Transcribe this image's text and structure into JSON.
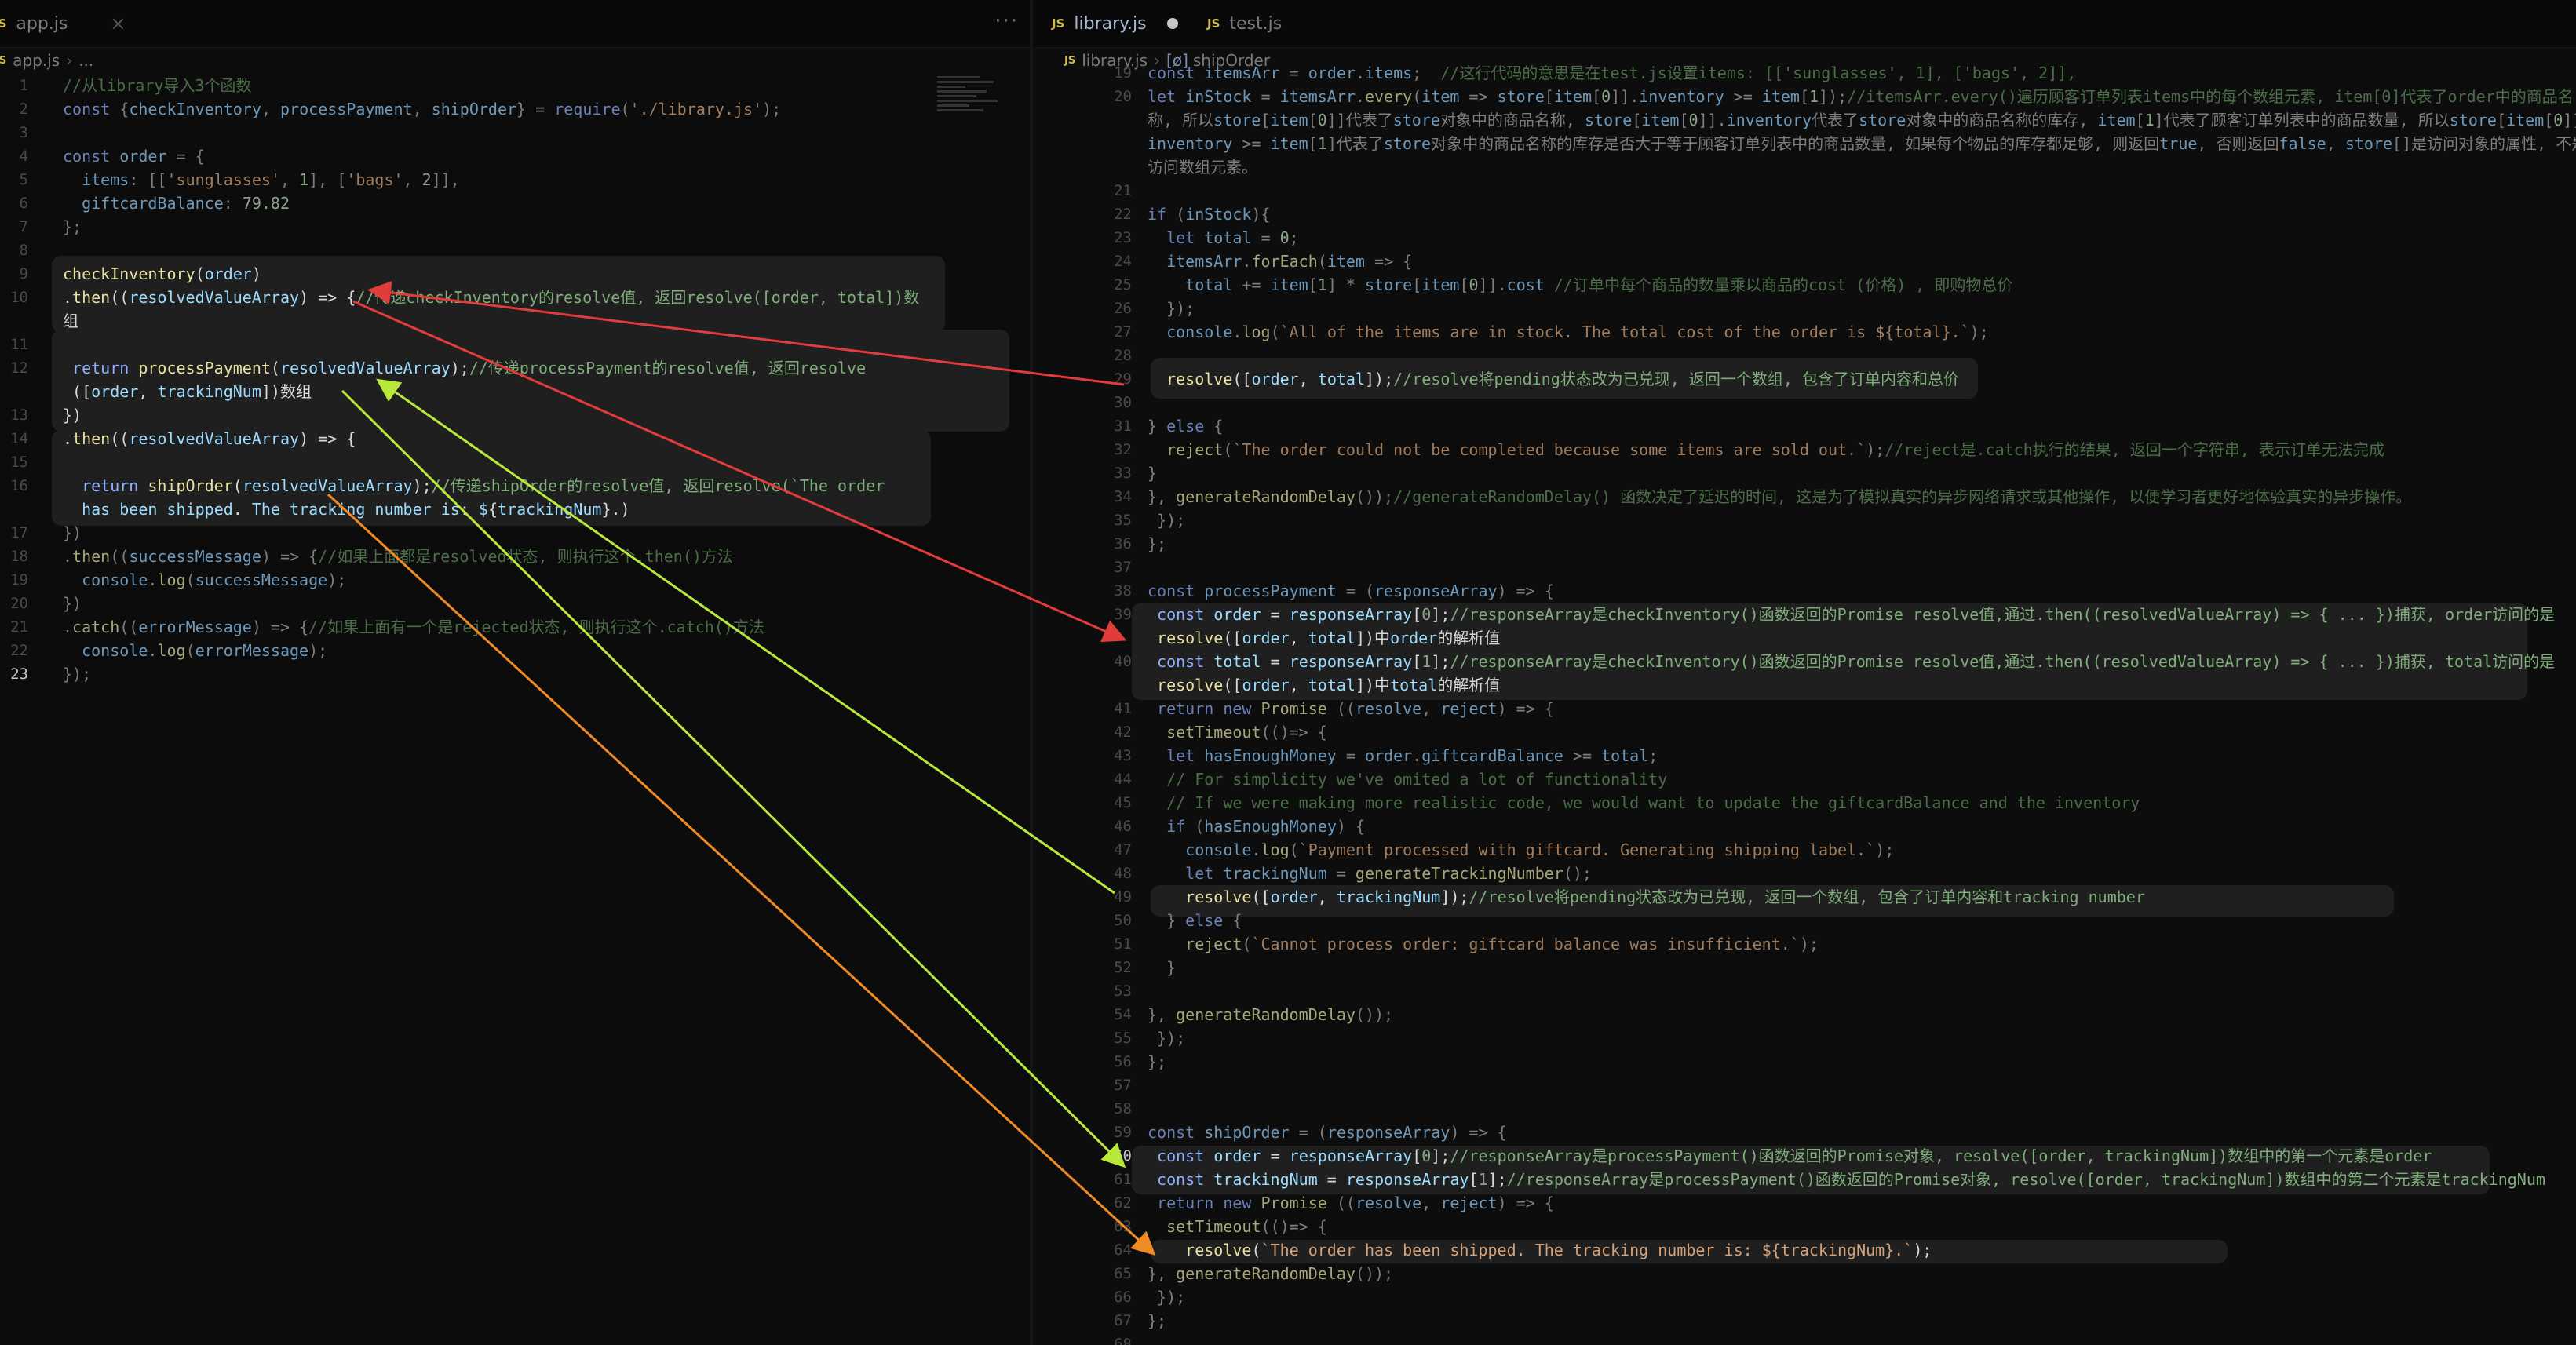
{
  "left_pane": {
    "tabs": [
      {
        "label": "app.js",
        "icon": "JS"
      }
    ],
    "more_label": "···",
    "breadcrumb": [
      "app.js",
      "..."
    ],
    "current_line": 23,
    "lines": [
      {
        "n": 1,
        "text": "//从library导入3个函数"
      },
      {
        "n": 2,
        "text": "const {checkInventory, processPayment, shipOrder} = require('./library.js');"
      },
      {
        "n": 3,
        "text": ""
      },
      {
        "n": 4,
        "text": "const order = {"
      },
      {
        "n": 5,
        "text": "  items: [['sunglasses', 1], ['bags', 2]],"
      },
      {
        "n": 6,
        "text": "  giftcardBalance: 79.82"
      },
      {
        "n": 7,
        "text": "};"
      },
      {
        "n": 8,
        "text": ""
      },
      {
        "n": 9,
        "text": "checkInventory(order)",
        "lit": true
      },
      {
        "n": 10,
        "text": ".then((resolvedValueArray) => {//传递checkInventory的resolve值, 返回resolve([order, total])数",
        "lit": true
      },
      {
        "n": null,
        "text": "组",
        "lit": true
      },
      {
        "n": 11,
        "text": ""
      },
      {
        "n": 12,
        "text": " return processPayment(resolvedValueArray);//传递processPayment的resolve值, 返回resolve",
        "lit": true
      },
      {
        "n": null,
        "text": " ([order, trackingNum])数组",
        "lit": true
      },
      {
        "n": 13,
        "text": "})",
        "lit": true
      },
      {
        "n": 14,
        "text": ".then((resolvedValueArray) => {",
        "lit": true
      },
      {
        "n": 15,
        "text": ""
      },
      {
        "n": 16,
        "text": "  return shipOrder(resolvedValueArray);//传递shipOrder的resolve值, 返回resolve(`The order",
        "lit": true
      },
      {
        "n": null,
        "text": "  has been shipped. The tracking number is: ${trackingNum}.`)",
        "lit": true
      },
      {
        "n": 17,
        "text": "})"
      },
      {
        "n": 18,
        "text": ".then((successMessage) => {//如果上面都是resolved状态, 则执行这个.then()方法"
      },
      {
        "n": 19,
        "text": "  console.log(successMessage);"
      },
      {
        "n": 20,
        "text": "})"
      },
      {
        "n": 21,
        "text": ".catch((errorMessage) => {//如果上面有一个是rejected状态, 则执行这个.catch()方法"
      },
      {
        "n": 22,
        "text": "  console.log(errorMessage);"
      },
      {
        "n": 23,
        "text": "});"
      }
    ]
  },
  "right_pane": {
    "tabs": [
      {
        "label": "library.js",
        "icon": "JS",
        "modified": true
      },
      {
        "label": "test.js",
        "icon": "JS"
      }
    ],
    "breadcrumb": [
      "library.js",
      "shipOrder"
    ],
    "breadcrumb_symbol": "[ø]",
    "current_line": 60,
    "lines": [
      {
        "n": 19,
        "text": "const itemsArr = order.items;  //这行代码的意思是在test.js设置items: [['sunglasses', 1], ['bags', 2]],"
      },
      {
        "n": 20,
        "text": "let inStock = itemsArr.every(item => store[item[0]].inventory >= item[1]);//itemsArr.every()遍历顾客订单列表items中的每个数组元素, item[0]代表了order中的商品名"
      },
      {
        "n": null,
        "text": "称, 所以store[item[0]]代表了store对象中的商品名称, store[item[0]].inventory代表了store对象中的商品名称的库存, item[1]代表了顾客订单列表中的商品数量, 所以store[item[0]]."
      },
      {
        "n": null,
        "text": "inventory >= item[1]代表了store对象中的商品名称的库存是否大于等于顾客订单列表中的商品数量, 如果每个物品的库存都足够, 则返回true, 否则返回false, store[]是访问对象的属性, 不是"
      },
      {
        "n": null,
        "text": "访问数组元素。"
      },
      {
        "n": 21,
        "text": ""
      },
      {
        "n": 22,
        "text": "if (inStock){"
      },
      {
        "n": 23,
        "text": "  let total = 0;"
      },
      {
        "n": 24,
        "text": "  itemsArr.forEach(item => {"
      },
      {
        "n": 25,
        "text": "    total += item[1] * store[item[0]].cost //订单中每个商品的数量乘以商品的cost (价格) , 即购物总价"
      },
      {
        "n": 26,
        "text": "  });"
      },
      {
        "n": 27,
        "text": "  console.log(`All of the items are in stock. The total cost of the order is ${total}.`);"
      },
      {
        "n": 28,
        "text": ""
      },
      {
        "n": 29,
        "text": "  resolve([order, total]);//resolve将pending状态改为已兑现, 返回一个数组, 包含了订单内容和总价",
        "lit": true
      },
      {
        "n": 30,
        "text": ""
      },
      {
        "n": 31,
        "text": "} else {"
      },
      {
        "n": 32,
        "text": "  reject(`The order could not be completed because some items are sold out.`);//reject是.catch执行的结果, 返回一个字符串, 表示订单无法完成"
      },
      {
        "n": 33,
        "text": "}"
      },
      {
        "n": 34,
        "text": "}, generateRandomDelay());//generateRandomDelay() 函数决定了延迟的时间, 这是为了模拟真实的异步网络请求或其他操作, 以便学习者更好地体验真实的异步操作。"
      },
      {
        "n": 35,
        "text": " });"
      },
      {
        "n": 36,
        "text": "};"
      },
      {
        "n": 37,
        "text": ""
      },
      {
        "n": 38,
        "text": "const processPayment = (responseArray) => {"
      },
      {
        "n": 39,
        "text": " const order = responseArray[0];//responseArray是checkInventory()函数返回的Promise resolve值,通过.then((resolvedValueArray) => { ... })捕获, order访问的是",
        "lit": true
      },
      {
        "n": null,
        "text": " resolve([order, total])中order的解析值",
        "lit": true
      },
      {
        "n": 40,
        "text": " const total = responseArray[1];//responseArray是checkInventory()函数返回的Promise resolve值,通过.then((resolvedValueArray) => { ... })捕获, total访问的是",
        "lit": true
      },
      {
        "n": null,
        "text": " resolve([order, total])中total的解析值",
        "lit": true
      },
      {
        "n": 41,
        "text": " return new Promise ((resolve, reject) => {"
      },
      {
        "n": 42,
        "text": "  setTimeout(()=> {"
      },
      {
        "n": 43,
        "text": "  let hasEnoughMoney = order.giftcardBalance >= total;"
      },
      {
        "n": 44,
        "text": "  // For simplicity we've omited a lot of functionality"
      },
      {
        "n": 45,
        "text": "  // If we were making more realistic code, we would want to update the giftcardBalance and the inventory"
      },
      {
        "n": 46,
        "text": "  if (hasEnoughMoney) {"
      },
      {
        "n": 47,
        "text": "    console.log(`Payment processed with giftcard. Generating shipping label.`);"
      },
      {
        "n": 48,
        "text": "    let trackingNum = generateTrackingNumber();"
      },
      {
        "n": 49,
        "text": "    resolve([order, trackingNum]);//resolve将pending状态改为已兑现, 返回一个数组, 包含了订单内容和tracking number",
        "lit": true
      },
      {
        "n": 50,
        "text": "  } else {"
      },
      {
        "n": 51,
        "text": "    reject(`Cannot process order: giftcard balance was insufficient.`);"
      },
      {
        "n": 52,
        "text": "  }"
      },
      {
        "n": 53,
        "text": ""
      },
      {
        "n": 54,
        "text": "}, generateRandomDelay());"
      },
      {
        "n": 55,
        "text": " });"
      },
      {
        "n": 56,
        "text": "};"
      },
      {
        "n": 57,
        "text": ""
      },
      {
        "n": 58,
        "text": ""
      },
      {
        "n": 59,
        "text": "const shipOrder = (responseArray) => {"
      },
      {
        "n": 60,
        "text": " const order = responseArray[0];//responseArray是processPayment()函数返回的Promise对象, resolve([order, trackingNum])数组中的第一个元素是order",
        "lit": true
      },
      {
        "n": 61,
        "text": " const trackingNum = responseArray[1];//responseArray是processPayment()函数返回的Promise对象, resolve([order, trackingNum])数组中的第二个元素是trackingNum",
        "lit": true
      },
      {
        "n": 62,
        "text": " return new Promise ((resolve, reject) => {"
      },
      {
        "n": 63,
        "text": "  setTimeout(()=> {"
      },
      {
        "n": 64,
        "text": "    resolve(`The order has been shipped. The tracking number is: ${trackingNum}.`);",
        "lit": true
      },
      {
        "n": 65,
        "text": "}, generateRandomDelay());"
      },
      {
        "n": 66,
        "text": " });"
      },
      {
        "n": 67,
        "text": "};"
      },
      {
        "n": 68,
        "text": ""
      }
    ]
  },
  "colors": {
    "arrow_red": "#e23b3b",
    "arrow_green": "#b8e83a",
    "arrow_orange": "#f08a24"
  }
}
